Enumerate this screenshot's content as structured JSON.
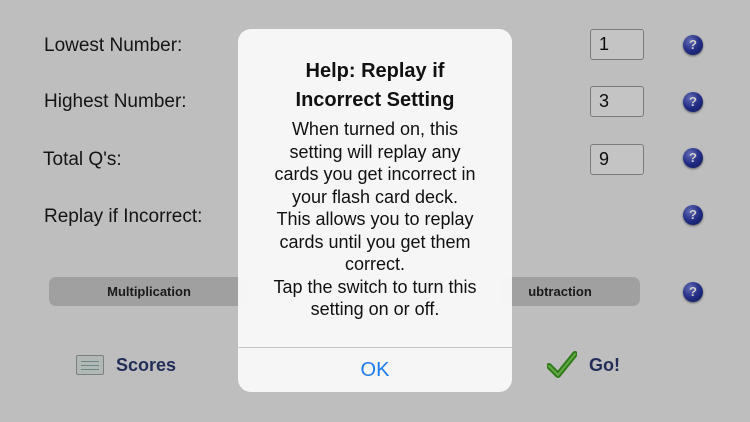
{
  "settings": {
    "lowest_label": "Lowest Number:",
    "lowest_value": "1",
    "highest_label": "Highest Number:",
    "highest_value": "3",
    "total_label": "Total Q's:",
    "total_value": "9",
    "replay_label": "Replay if Incorrect:",
    "help_glyph": "?"
  },
  "operations": {
    "left_label": "Multiplication",
    "right_label": "ubtraction"
  },
  "bottom": {
    "scores_label": "Scores",
    "go_label": "Go!"
  },
  "alert": {
    "title_lines": [
      "Help: Replay if",
      "Incorrect Setting"
    ],
    "message_lines": [
      "When turned on, this",
      "setting will replay any",
      "cards you get incorrect in",
      "your flash card deck.",
      "This allows you to replay",
      "cards until you get them",
      "correct.",
      "Tap the switch to turn this",
      "setting on or off."
    ],
    "ok_label": "OK"
  },
  "colors": {
    "accent_link": "#1f7bf2",
    "help_icon": "#2c3aa8",
    "button_text": "#2b3a6e",
    "check_green": "#3a9a1e"
  }
}
